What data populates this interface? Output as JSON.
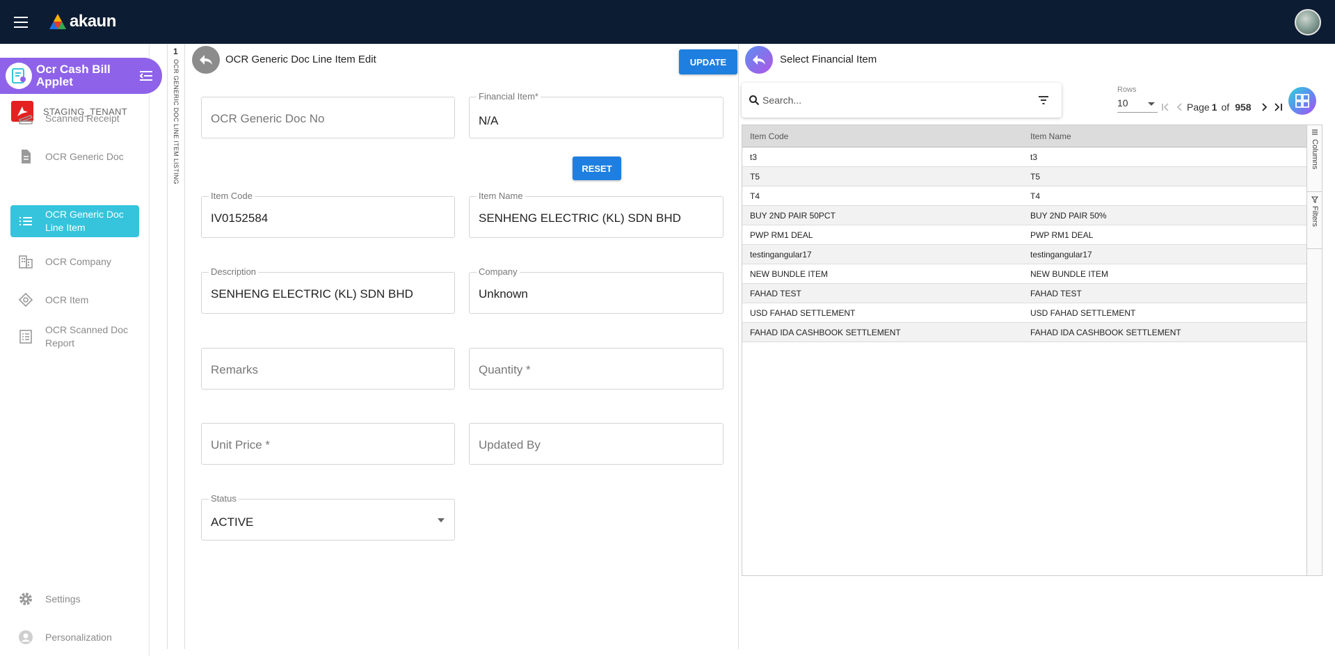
{
  "header": {
    "brand": "akaun"
  },
  "sidebar": {
    "applet_title": "Ocr Cash Bill Applet",
    "tenant": "STAGING_TENANT",
    "items": [
      {
        "label": "Scanned Receipt",
        "icon": "scanner-icon"
      },
      {
        "label": "OCR Generic Doc",
        "icon": "document-icon"
      },
      {
        "label": "OCR Generic Doc Line Item",
        "icon": "list-icon",
        "active": true
      },
      {
        "label": "OCR Company",
        "icon": "building-icon"
      },
      {
        "label": "OCR Item",
        "icon": "item-icon"
      },
      {
        "label": "OCR Scanned Doc Report",
        "icon": "report-icon"
      }
    ],
    "settings": "Settings",
    "personalization": "Personalization"
  },
  "strip": {
    "number": "1",
    "label": "OCR GENERIC DOC LINE ITEM LISTING"
  },
  "edit": {
    "title": "OCR Generic Doc Line Item Edit",
    "update_label": "UPDATE",
    "reset_label": "RESET",
    "fields": {
      "doc_no": {
        "placeholder": "OCR Generic Doc No"
      },
      "financial_item": {
        "label": "Financial Item*",
        "value": "N/A"
      },
      "item_code": {
        "label": "Item Code",
        "value": "IV0152584"
      },
      "item_name": {
        "label": "Item Name",
        "value": "SENHENG ELECTRIC (KL) SDN BHD"
      },
      "description": {
        "label": "Description",
        "value": "SENHENG ELECTRIC (KL) SDN BHD"
      },
      "company": {
        "label": "Company",
        "value": "Unknown"
      },
      "remarks": {
        "placeholder": "Remarks"
      },
      "quantity": {
        "placeholder": "Quantity *"
      },
      "unit_price": {
        "placeholder": "Unit Price *"
      },
      "updated_by": {
        "placeholder": "Updated By"
      },
      "status": {
        "label": "Status",
        "value": "ACTIVE"
      }
    }
  },
  "picker": {
    "title": "Select Financial Item",
    "search_placeholder": "Search...",
    "rows_label": "Rows",
    "rows_value": "10",
    "page_label": "Page",
    "page_current": "1",
    "page_of": "of",
    "page_total": "958",
    "columns": [
      "Item Code",
      "Item Name"
    ],
    "rows": [
      [
        "t3",
        "t3"
      ],
      [
        "T5",
        "T5"
      ],
      [
        "T4",
        "T4"
      ],
      [
        "BUY 2ND PAIR 50PCT",
        "BUY 2ND PAIR 50%"
      ],
      [
        "PWP RM1 DEAL",
        "PWP RM1 DEAL"
      ],
      [
        "testingangular17",
        "testingangular17"
      ],
      [
        "NEW BUNDLE ITEM",
        "NEW BUNDLE ITEM"
      ],
      [
        "FAHAD TEST",
        "FAHAD TEST"
      ],
      [
        "USD FAHAD SETTLEMENT",
        "USD FAHAD SETTLEMENT"
      ],
      [
        "FAHAD IDA CASHBOOK SETTLEMENT",
        "FAHAD IDA CASHBOOK SETTLEMENT"
      ]
    ],
    "side_tabs": [
      "Columns",
      "Filters"
    ]
  },
  "colors": {
    "topbar": "#0c1c33",
    "applet": "#8e63e9",
    "active_nav": "#35c4dc",
    "button": "#1e7fe0"
  }
}
